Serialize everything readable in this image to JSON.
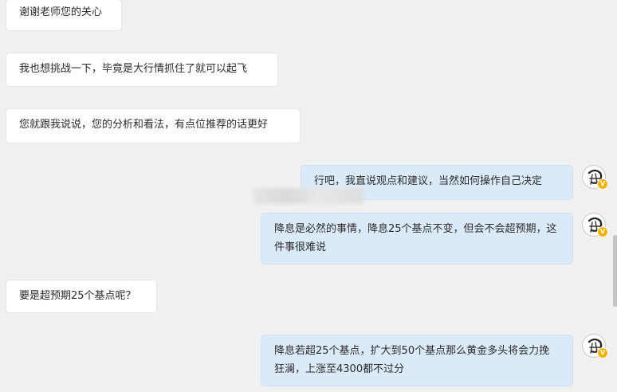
{
  "messages": [
    {
      "side": "left",
      "text": "谢谢老师您的关心"
    },
    {
      "side": "left",
      "text": "我也想挑战一下，毕竟是大行情抓住了就可以起飞"
    },
    {
      "side": "left",
      "text": "您就跟我说说，您的分析和看法，有点位推荐的话更好"
    },
    {
      "side": "right",
      "text": "行吧，我直说观点和建议，当然如何操作自己决定"
    },
    {
      "side": "right",
      "text": "降息是必然的事情，降息25个基点不变，但会不会超预期，这件事很难说"
    },
    {
      "side": "left",
      "text": "要是超预期25个基点呢？"
    },
    {
      "side": "right",
      "text": "降息若超25个基点，扩大到50个基点那么黄金多头将会力挽狂澜，上涨至4300都不过分"
    }
  ],
  "avatar": {
    "icon": "ink-figure-avatar-icon",
    "badge": "V",
    "badge_color": "#f4b400"
  },
  "colors": {
    "background": "#f0f0f0",
    "left_bubble": "#ffffff",
    "right_bubble": "#dbeaf8"
  }
}
